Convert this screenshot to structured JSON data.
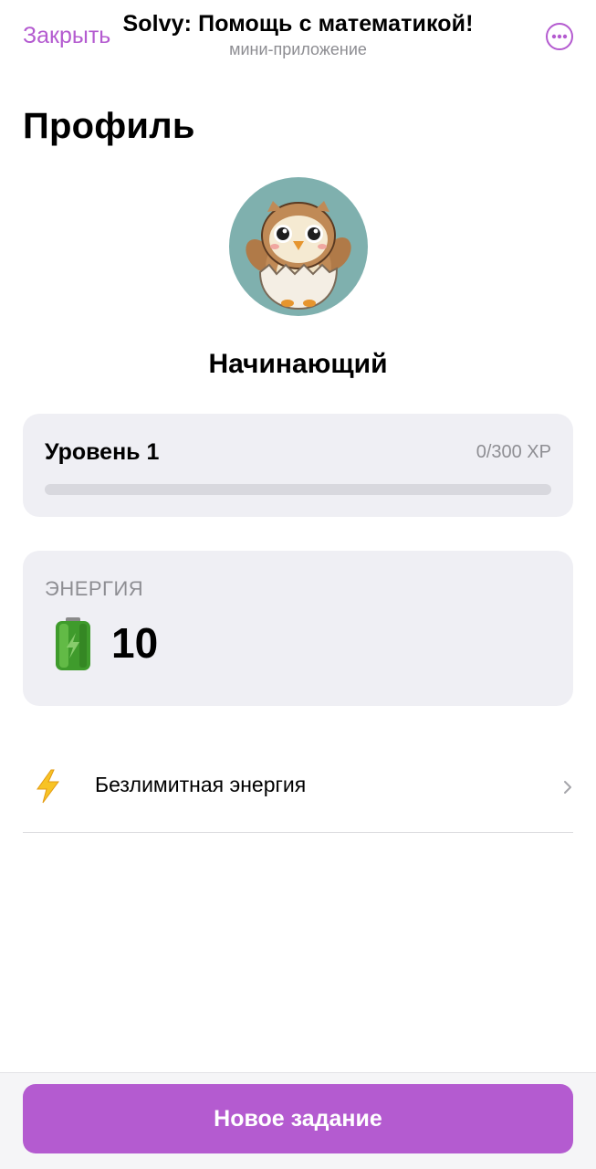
{
  "header": {
    "close_label": "Закрыть",
    "title": "Solvy: Помощь с математикой!",
    "subtitle": "мини-приложение",
    "more_icon": "more-horizontal-icon"
  },
  "profile": {
    "title": "Профиль",
    "avatar": "owl-hatchling-avatar",
    "rank": "Начинающий"
  },
  "level": {
    "title": "Уровень 1",
    "xp_text": "0/300 XP",
    "progress_fraction": 0
  },
  "energy": {
    "label": "ЭНЕРГИЯ",
    "value": "10",
    "icon": "battery-icon"
  },
  "unlimited": {
    "label": "Безлимитная энергия",
    "icon": "lightning-icon",
    "chevron_icon": "chevron-right-icon"
  },
  "bottom": {
    "button_label": "Новое задание"
  },
  "colors": {
    "accent": "#b45bd0",
    "card_bg": "#efeff4",
    "muted_text": "#8e8e93",
    "avatar_bg": "#7fb0ae"
  }
}
